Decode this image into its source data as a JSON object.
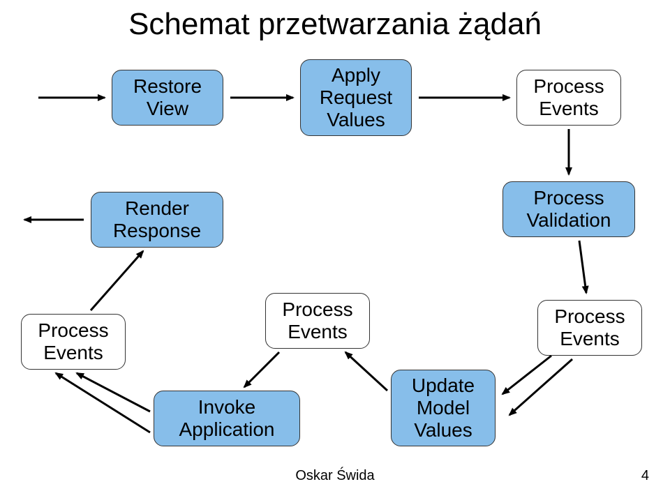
{
  "title": "Schemat przetwarzania żądań",
  "nodes": {
    "restore_view": "Restore\nView",
    "apply_request_values": "Apply\nRequest\nValues",
    "process_events_tr": "Process\nEvents",
    "render_response": "Render\nResponse",
    "process_validation": "Process\nValidation",
    "process_events_left": "Process\nEvents",
    "invoke_application": "Invoke\nApplication",
    "process_events_mid": "Process\nEvents",
    "update_model_values": "Update\nModel\nValues",
    "process_events_right": "Process\nEvents"
  },
  "footer": {
    "author": "Oskar Świda",
    "page": "4"
  }
}
